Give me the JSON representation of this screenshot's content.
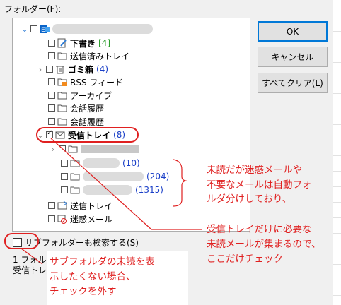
{
  "dialog": {
    "folder_label": "フォルダー(F):",
    "ok_label": "OK",
    "cancel_label": "キャンセル",
    "clear_label": "すべてクリア(L)",
    "subfolder_label": "サブフォルダーも検索する(S)",
    "status_line1": "1 フォル",
    "status_line2": "受信トレ"
  },
  "tree": {
    "drafts": {
      "label": "下書き",
      "count": "[4]"
    },
    "sent_items": {
      "label": "送信済みトレイ"
    },
    "trash": {
      "label": "ゴミ箱",
      "count": "(4)"
    },
    "rss": {
      "label": "RSS フィード"
    },
    "archive": {
      "label": "アーカイブ"
    },
    "conv1": {
      "label": "会話履歴"
    },
    "conv2": {
      "label": "会話履歴"
    },
    "inbox": {
      "label": "受信トレイ",
      "count": "(8)"
    },
    "sub1": {
      "label": "…"
    },
    "sub2": {
      "count": "(10)"
    },
    "sub3": {
      "count": "(204)"
    },
    "sub4": {
      "count": "(1315)"
    },
    "outbox": {
      "label": "送信トレイ"
    },
    "junk": {
      "label": "迷惑メール"
    }
  },
  "annotations": {
    "right_top_1": "未読だが迷惑メールや",
    "right_top_2": "不要なメールは自動フォ",
    "right_top_3": "ルダ分けしており、",
    "right_bottom_1": "受信トレイだけに必要な",
    "right_bottom_2": "未読メールが集まるので、",
    "right_bottom_3": "ここだけチェック",
    "left_bottom_1": "サブフォルダの未読を表",
    "left_bottom_2": "示したくない場合、",
    "left_bottom_3": "チェックを外す"
  },
  "colors": {
    "annotation": "#e02020",
    "count_blue": "#1a3fc8",
    "count_green": "#2a9d2a",
    "accent": "#0078d7"
  }
}
